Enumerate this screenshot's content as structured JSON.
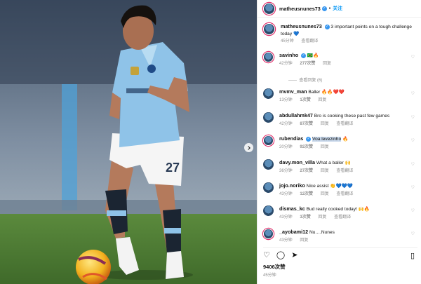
{
  "post": {
    "author": "matheusnunes73",
    "follow_label": "关注",
    "caption": "3 important points on a tough challenge today",
    "caption_emoji": "💙",
    "caption_time": "45分钟",
    "caption_translate": "查看翻译",
    "likes": "9406次赞",
    "time": "45分钟"
  },
  "comments": [
    {
      "user": "savinho",
      "emoji": "🇧🇷🔥",
      "text": "",
      "time": "42分钟",
      "likes": "277次赞",
      "reply": "回复",
      "verified": true
    },
    {
      "user": "mvmv_man",
      "text": "Baller 🔥🔥❤️❤️",
      "time": "13分钟",
      "likes": "1次赞",
      "reply": "回复"
    },
    {
      "user": "abdullahmk47",
      "text": "Bro is cooking these past few games",
      "time": "42分钟",
      "likes": "87次赞",
      "reply": "回复",
      "translate": "查看翻译"
    },
    {
      "user": "rubendias",
      "text": "Voa levezinho",
      "emoji": "🔥",
      "time": "20分钟",
      "likes": "92次赞",
      "reply": "回复",
      "verified": true
    },
    {
      "user": "davy.mon_villa",
      "text": "What a baller 🙌",
      "time": "36分钟",
      "likes": "27次赞",
      "reply": "回复",
      "translate": "查看翻译"
    },
    {
      "user": "jojo.noriko",
      "text": "Nice assist 👏💙💙💙",
      "time": "43分钟",
      "likes": "12次赞",
      "reply": "回复",
      "translate": "查看翻译"
    },
    {
      "user": "dismas_kc",
      "text": "Bud really cooked today! 🙌🔥",
      "time": "43分钟",
      "likes": "3次赞",
      "reply": "回复",
      "translate": "查看翻译"
    },
    {
      "user": "_ayobami12",
      "text": "Nu….Nunes",
      "time": "43分钟",
      "likes": "",
      "reply": "回复"
    }
  ],
  "view_replies": "查看回复 (6)",
  "icons": [
    "heart-icon",
    "comment-icon",
    "share-icon",
    "bookmark-icon",
    "verified-icon",
    "chevron-right-icon"
  ],
  "colors": {
    "link": "#0095f6",
    "verified": "#3897f0",
    "kit": "#8fc3e8",
    "muted": "#8e8e8e"
  }
}
